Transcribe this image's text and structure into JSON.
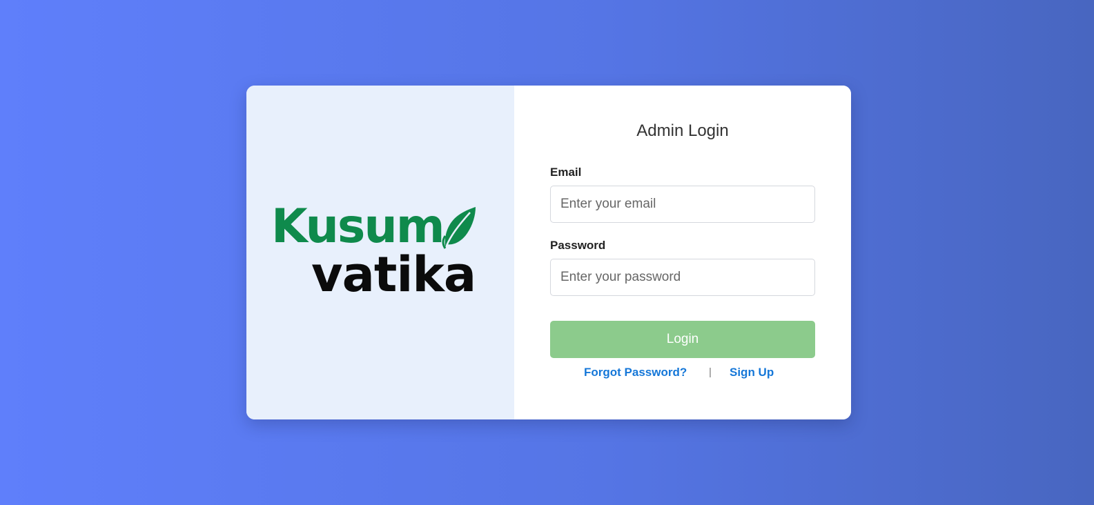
{
  "brand": {
    "name_line1": "Kusum",
    "name_line2": "vatika",
    "primary_color": "#0f8a4c",
    "secondary_color": "#0b0b0b",
    "icon": "leaf-icon"
  },
  "login": {
    "title": "Admin Login",
    "email_label": "Email",
    "email_placeholder": "Enter your email",
    "email_value": "",
    "password_label": "Password",
    "password_placeholder": "Enter your password",
    "password_value": "",
    "submit_label": "Login",
    "submit_color": "#8ccb8c",
    "forgot_link": "Forgot Password?",
    "separator": "|",
    "signup_link": "Sign Up",
    "link_color": "#1577d8"
  },
  "colors": {
    "background_start": "#5f7ffb",
    "background_end": "#4866c0",
    "left_panel": "#e8f0fc"
  }
}
